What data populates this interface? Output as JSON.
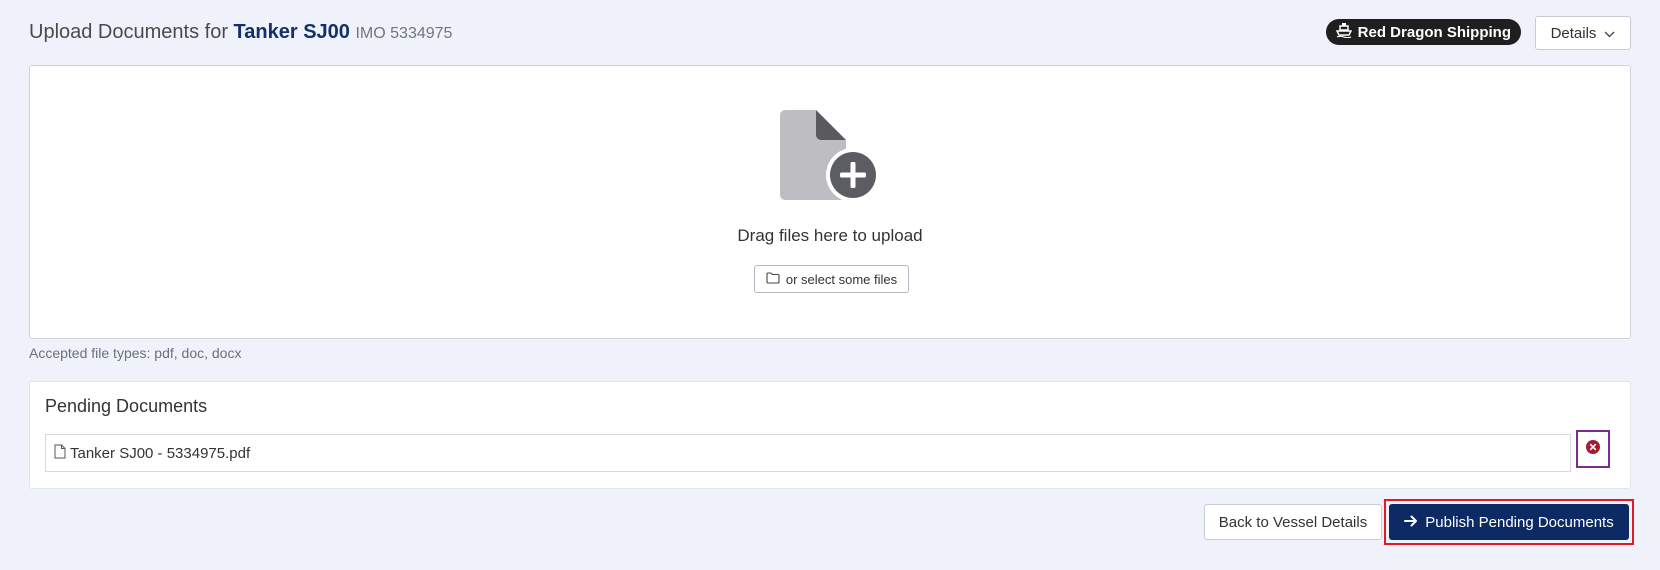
{
  "header": {
    "title_prefix": "Upload Documents for",
    "vessel_name": "Tanker SJ00",
    "imo": "IMO 5334975",
    "company": "Red Dragon Shipping",
    "company_icon": "ship-icon",
    "details_label": "Details"
  },
  "dropzone": {
    "drag_text": "Drag files here to upload",
    "select_label": "or select some files"
  },
  "accepted_types": "Accepted file types: pdf, doc, docx",
  "pending": {
    "title": "Pending Documents",
    "files": [
      {
        "name": "Tanker SJ00 - 5334975.pdf"
      }
    ]
  },
  "actions": {
    "back_label": "Back to Vessel Details",
    "publish_label": "Publish Pending Documents"
  },
  "colors": {
    "background": "#eff2fb",
    "brand_navy": "#0c2a63",
    "vessel_text": "#12306b",
    "badge_bg": "#1f1f1f",
    "remove_red": "#a51c30",
    "highlight_red": "#e01b24",
    "highlight_purple": "#7b2d8e"
  }
}
